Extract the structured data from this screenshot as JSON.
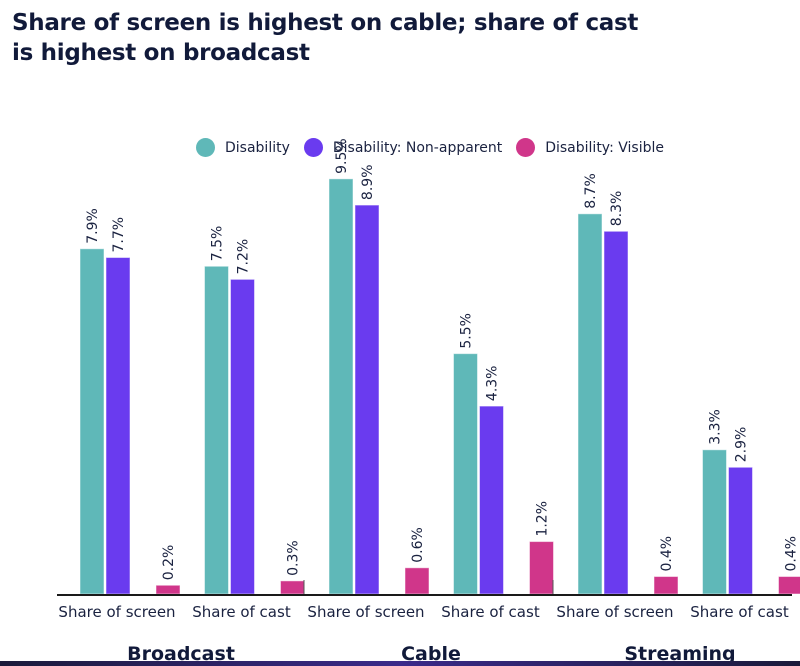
{
  "chart_data": {
    "type": "bar",
    "title": "Share of screen is highest on cable; share of cast is highest on broadcast",
    "title_lines": [
      "Share of screen is highest on cable; share of cast",
      "is highest on broadcast"
    ],
    "xlabel": "",
    "ylabel": "",
    "ylim": [
      0,
      10
    ],
    "grid": false,
    "legend_position": "top-center",
    "value_format": "percent",
    "groups": [
      "Broadcast",
      "Cable",
      "Streaming"
    ],
    "categories": [
      "Share of screen",
      "Share of cast",
      "Share of screen",
      "Share of cast",
      "Share of screen",
      "Share of cast"
    ],
    "category_group": [
      0,
      0,
      1,
      1,
      2,
      2
    ],
    "series": [
      {
        "name": "Disability",
        "color": "#5fb8b8",
        "values": [
          7.9,
          7.5,
          9.5,
          5.5,
          8.7,
          3.3
        ],
        "labels": [
          "7.9%",
          "7.5%",
          "9.5%",
          "5.5%",
          "8.7%",
          "3.3%"
        ]
      },
      {
        "name": "Disability: Non-apparent",
        "color": "#6a3bef",
        "values": [
          7.7,
          7.2,
          8.9,
          4.3,
          8.3,
          2.9
        ],
        "labels": [
          "7.7%",
          "7.2%",
          "8.9%",
          "4.3%",
          "8.3%",
          "2.9%"
        ]
      },
      {
        "name": "Disability: Visible",
        "color": "#d0368a",
        "values": [
          0.2,
          0.3,
          0.6,
          1.2,
          0.4,
          0.4
        ],
        "labels": [
          "0.2%",
          "0.3%",
          "0.6%",
          "1.2%",
          "0.4%",
          "0.4%"
        ]
      }
    ]
  },
  "legend": {
    "items": [
      {
        "label": "Disability",
        "color": "#5fb8b8"
      },
      {
        "label": "Disability: Non-apparent",
        "color": "#6a3bef"
      },
      {
        "label": "Disability: Visible",
        "color": "#d0368a"
      }
    ]
  }
}
